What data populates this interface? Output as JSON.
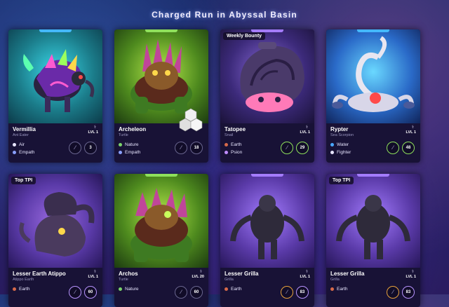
{
  "title": "Charged Run in Abyssal Basin",
  "icons": {
    "slot": "leaf-icon",
    "level": "flask-icon"
  },
  "colors": {
    "nature": "#7bd36b",
    "earth": "#d66a4a",
    "air": "#e8e6ff",
    "water": "#4aa8ff",
    "psion": "#c08cff"
  },
  "cards": [
    {
      "name": "Vermillia",
      "species": "Ant Eater",
      "level": "LVL 1",
      "elements": [
        "Air",
        "Empath"
      ],
      "number": "3",
      "badge": ""
    },
    {
      "name": "Archeleon",
      "species": "Turtle",
      "level": "LVL 1",
      "elements": [
        "Nature",
        "Empath"
      ],
      "number": "18",
      "badge": ""
    },
    {
      "name": "Tatopee",
      "species": "Snail",
      "level": "LVL 1",
      "elements": [
        "Earth",
        "Psion"
      ],
      "number": "29",
      "badge": "Weekly Bounty"
    },
    {
      "name": "Rypter",
      "species": "Sea Scorpion",
      "level": "LVL 1",
      "elements": [
        "Water",
        "Fighter"
      ],
      "number": "48",
      "badge": ""
    },
    {
      "name": "Lesser Earth Atippo",
      "species": "Atippo Earth",
      "level": "LVL 1",
      "elements": [
        "Earth"
      ],
      "number": "60",
      "badge": "Top TPI"
    },
    {
      "name": "Archos",
      "species": "Turtle",
      "level": "LVL 20",
      "elements": [
        "Nature"
      ],
      "number": "60",
      "badge": ""
    },
    {
      "name": "Lesser Grilla",
      "species": "Grilla",
      "level": "LVL 1",
      "elements": [
        "Earth"
      ],
      "number": "83",
      "badge": ""
    },
    {
      "name": "Lesser Grilla",
      "species": "Grilla",
      "level": "LVL 1",
      "elements": [
        "Earth"
      ],
      "number": "83",
      "badge": "Top TPI"
    }
  ]
}
